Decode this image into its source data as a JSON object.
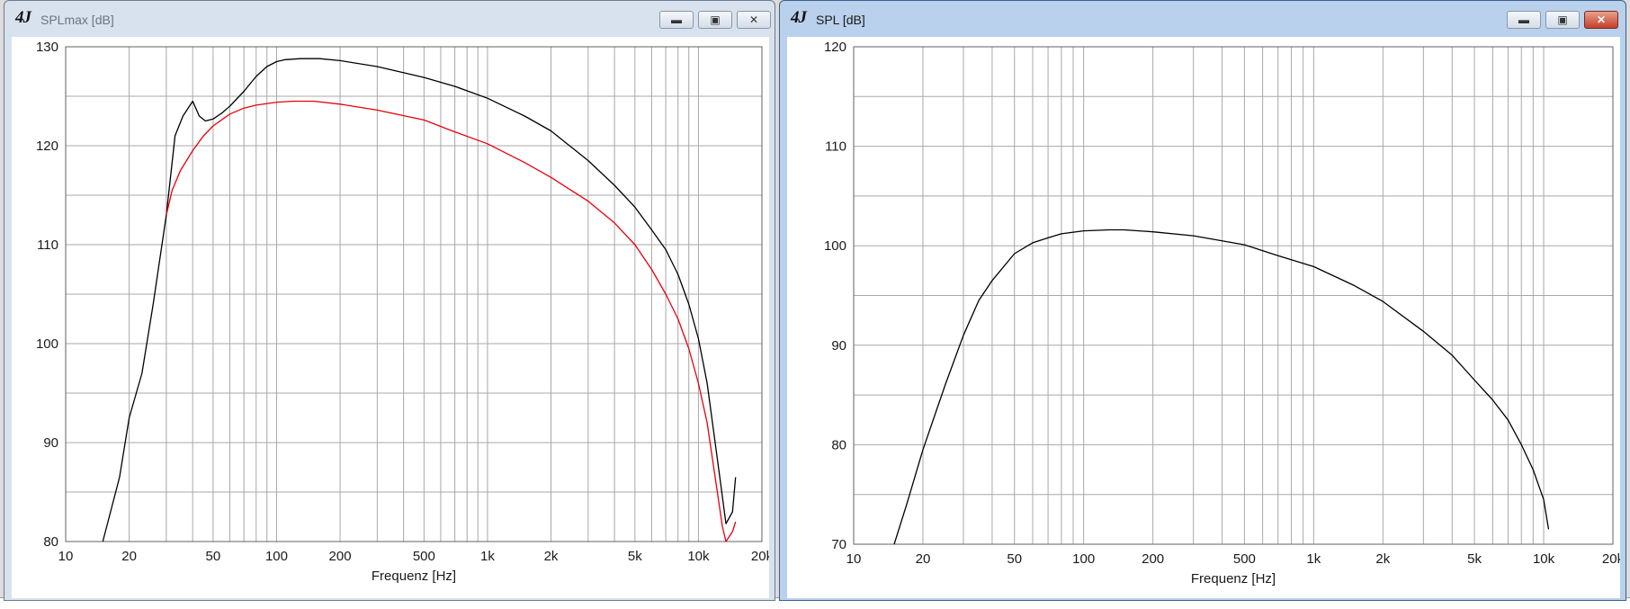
{
  "windows": [
    {
      "title": "SPLmax [dB]",
      "app_icon": "4J",
      "state": "inactive",
      "buttons": {
        "minimize": "minimize-icon",
        "maximize": "maximize-icon",
        "close": "close-icon"
      },
      "chart_data": {
        "type": "line",
        "xlabel": "Frequenz [Hz]",
        "ylabel": "",
        "xscale": "log",
        "xlim": [
          10,
          20000
        ],
        "ylim": [
          80,
          130
        ],
        "x_ticks": [
          10,
          20,
          50,
          100,
          200,
          500,
          1000,
          2000,
          5000,
          10000,
          20000
        ],
        "x_tick_labels": [
          "10",
          "20",
          "50",
          "100",
          "200",
          "500",
          "1k",
          "2k",
          "5k",
          "10k",
          "20k"
        ],
        "y_ticks": [
          80,
          90,
          100,
          110,
          120,
          130
        ],
        "grid": true,
        "series": [
          {
            "color": "#000000",
            "x": [
              15,
              18,
              20,
              23,
              26,
              30,
              33,
              36,
              40,
              43,
              46,
              50,
              55,
              60,
              70,
              80,
              90,
              100,
              110,
              130,
              160,
              200,
              300,
              500,
              700,
              1000,
              1500,
              2000,
              3000,
              4000,
              5000,
              6000,
              7000,
              8000,
              9000,
              10000,
              11000,
              12000,
              13000,
              13500,
              14500,
              15000
            ],
            "y": [
              80,
              86.5,
              92.5,
              97,
              104,
              113,
              121,
              123,
              124.5,
              123,
              122.5,
              122.7,
              123.3,
              124,
              125.5,
              127,
              128,
              128.5,
              128.7,
              128.8,
              128.8,
              128.6,
              128,
              126.9,
              126,
              124.8,
              123,
              121.5,
              118.5,
              116,
              113.8,
              111.5,
              109.5,
              107,
              104,
              100.5,
              96,
              90,
              84.5,
              81.8,
              83,
              86.5
            ]
          },
          {
            "color": "#e8000c",
            "x": [
              30,
              32,
              35,
              40,
              45,
              50,
              60,
              70,
              80,
              100,
              120,
              150,
              200,
              300,
              500,
              700,
              1000,
              1500,
              2000,
              3000,
              4000,
              5000,
              6000,
              7000,
              8000,
              9000,
              10000,
              11000,
              12000,
              13000,
              13500,
              14500,
              15000
            ],
            "y": [
              113,
              115.5,
              117.5,
              119.5,
              121,
              122,
              123.2,
              123.8,
              124.1,
              124.4,
              124.5,
              124.5,
              124.2,
              123.6,
              122.6,
              121.4,
              120.2,
              118.3,
              116.8,
              114.4,
              112.2,
              110,
              107.5,
              105,
              102.5,
              99.5,
              96,
              92,
              86.5,
              81.5,
              80,
              81,
              82
            ]
          }
        ]
      }
    },
    {
      "title": "SPL [dB]",
      "app_icon": "4J",
      "state": "active",
      "buttons": {
        "minimize": "minimize-icon",
        "maximize": "maximize-icon",
        "close": "close-icon"
      },
      "chart_data": {
        "type": "line",
        "xlabel": "Frequenz [Hz]",
        "ylabel": "",
        "xscale": "log",
        "xlim": [
          10,
          20000
        ],
        "ylim": [
          70,
          120
        ],
        "x_ticks": [
          10,
          20,
          50,
          100,
          200,
          500,
          1000,
          2000,
          5000,
          10000,
          20000
        ],
        "x_tick_labels": [
          "10",
          "20",
          "50",
          "100",
          "200",
          "500",
          "1k",
          "2k",
          "5k",
          "10k",
          "20k"
        ],
        "y_ticks": [
          70,
          80,
          90,
          100,
          110,
          120
        ],
        "grid": true,
        "series": [
          {
            "color": "#000000",
            "x": [
              15,
              17,
              20,
              25,
              30,
              35,
              40,
              50,
              60,
              70,
              80,
              100,
              130,
              150,
              200,
              300,
              500,
              700,
              1000,
              1500,
              2000,
              3000,
              4000,
              5000,
              6000,
              7000,
              8000,
              9000,
              10000,
              10500
            ],
            "y": [
              70,
              74,
              79.5,
              86,
              91,
              94.5,
              96.5,
              99.2,
              100.3,
              100.8,
              101.2,
              101.5,
              101.6,
              101.6,
              101.4,
              101,
              100.1,
              99,
              97.9,
              96,
              94.4,
              91.4,
              89,
              86.5,
              84.5,
              82.5,
              80,
              77.5,
              74.5,
              71.5
            ]
          }
        ]
      }
    }
  ]
}
